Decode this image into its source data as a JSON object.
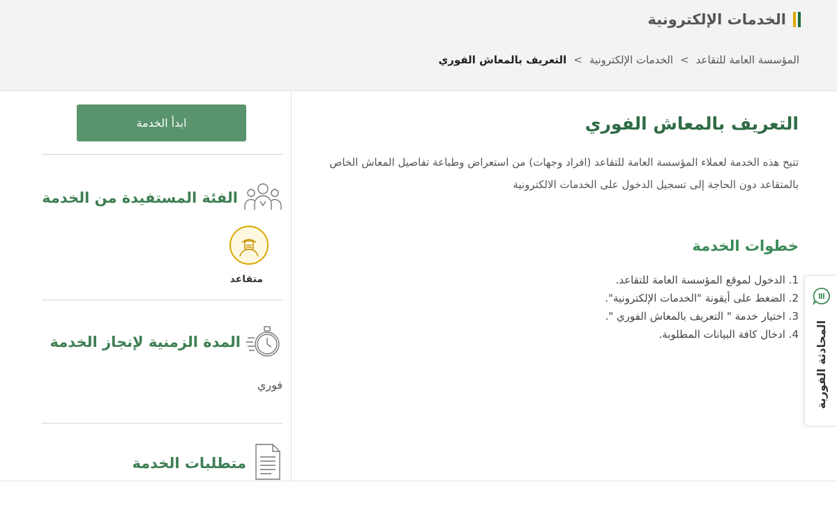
{
  "header": {
    "title": "الخدمات الإلكترونية",
    "breadcrumb": [
      "المؤسسة العامة للتقاعد",
      "الخدمات الإلكترونية",
      "التعريف بالمعاش الفوري"
    ],
    "separator": ">"
  },
  "main": {
    "title": "التعريف بالمعاش الفوري",
    "description": "تتيح هذه الخدمة لعملاء المؤسسة العامة للتقاعد (افراد وجهات) من استعراض وطباعة تفاصيل المعاش الخاص بالمتقاعد دون الحاجة إلى تسجيل الدخول على الخدمات الالكترونية",
    "steps_title": "خطوات الخدمة",
    "steps": [
      "1. الدخول لموقع المؤسسة العامة للتقاعد.",
      "2. الضغط على أيقونة \"الخدمات الإلكترونية\".",
      "3. اختيار خدمة \" التعريف بالمعاش الفوري \".",
      "4. ادخال كافة البيانات المطلوبة."
    ]
  },
  "sidebar": {
    "start_button": "ابدأ الخدمة",
    "beneficiary_title": "الفئة المستفيدة من الخدمة",
    "beneficiary_label": "متقاعد",
    "duration_title": "المدة الزمنية لإنجاز الخدمة",
    "duration_value": "فوري",
    "requirements_title": "متطلبات الخدمة"
  },
  "chat": {
    "label": "المحادثة الفورية"
  },
  "colors": {
    "primary_green": "#59946d",
    "heading_green": "#3e7f53",
    "accent_gold": "#d9a700"
  },
  "icons": [
    "people-icon",
    "retiree-icon",
    "stopwatch-icon",
    "document-icon",
    "chat-icon"
  ]
}
